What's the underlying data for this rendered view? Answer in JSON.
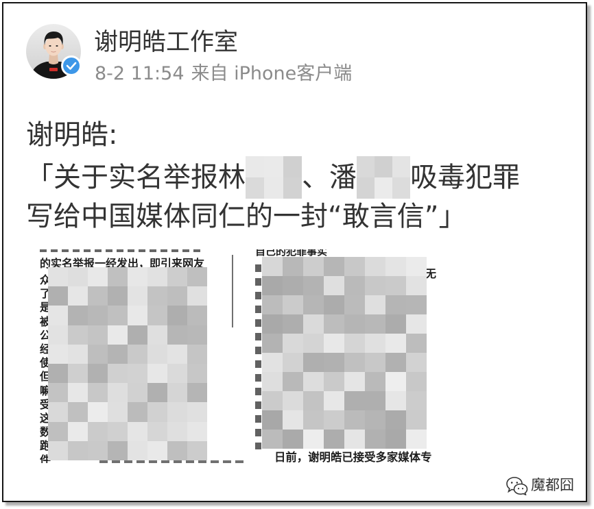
{
  "post": {
    "author": {
      "name": "谢明皓工作室",
      "verified": true,
      "verified_icon": "verified-badge-icon"
    },
    "meta": {
      "time": "8-2 11:54",
      "source": "来自 iPhone客户端"
    },
    "content": {
      "line1": "谢明皓:",
      "line2": {
        "part1": "「关于实名举报林",
        "part2": "、潘",
        "part3": "吸毒犯罪"
      },
      "line3": "写给中国媒体同仁的一封“敢言信”」"
    },
    "image": {
      "left_page": {
        "line": "的实名举报一经发出，即引来网友",
        "margin_chars": [
          "众",
          "了",
          "是",
          "被",
          "公",
          "经",
          "使",
          "但",
          "嘛",
          "受",
          "这",
          "数",
          "跑",
          "件"
        ]
      },
      "right_page": {
        "top_line": "自己的犯罪事实",
        "edge_char": "无",
        "bottom_line": "日前，谢明皓已接受多家媒体专"
      }
    }
  },
  "watermark": {
    "icon": "wechat-icon",
    "text": "魔都囧"
  },
  "colors": {
    "text": "#333333",
    "meta": "#8b8b8b",
    "verified_badge": "#3d97e8",
    "frame_border": "#151515"
  }
}
